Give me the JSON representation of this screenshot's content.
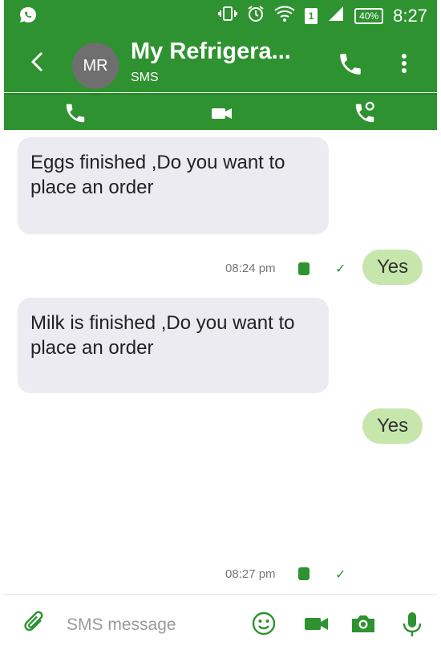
{
  "status_bar": {
    "battery": "40%",
    "time": "8:27",
    "sim_slot": "1"
  },
  "header": {
    "avatar_initials": "MR",
    "title": "My Refrigera...",
    "subtitle": "SMS"
  },
  "messages": [
    {
      "direction": "incoming",
      "text": "Eggs finished ,Do you want to place an order"
    },
    {
      "direction": "outgoing",
      "text": "Yes",
      "time": "08:24 pm"
    },
    {
      "direction": "incoming",
      "text": "Milk is finished ,Do you want to place an order"
    },
    {
      "direction": "outgoing",
      "text": "Yes",
      "time": "08:27 pm"
    }
  ],
  "composer": {
    "placeholder": "SMS message"
  },
  "colors": {
    "primary": "#2e9230",
    "outgoing_bubble": "#c6e6ac",
    "incoming_bubble": "#ebebf1"
  },
  "icons": [
    "whatsapp-icon",
    "vibrate-icon",
    "alarm-icon",
    "wifi-icon",
    "signal-icon",
    "back-icon",
    "phone-icon",
    "more-icon",
    "video-icon",
    "location-call-icon",
    "attach-icon",
    "emoji-icon",
    "camera-icon",
    "mic-icon",
    "sim-icon",
    "check-icon"
  ]
}
